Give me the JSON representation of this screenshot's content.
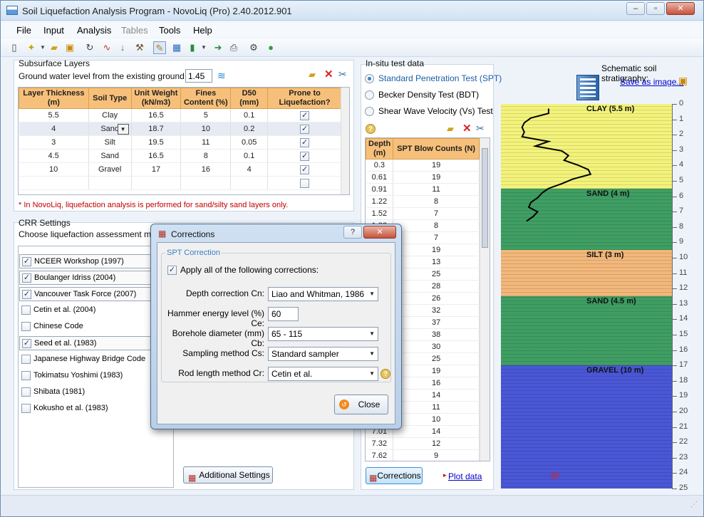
{
  "window": {
    "title": "Soil Liquefaction Analysis Program - NovoLiq (Pro) 2.40.2012.901",
    "min": "‒",
    "max": "▫",
    "close": "✕"
  },
  "menu": [
    "File",
    "Input",
    "Analysis",
    "Tables",
    "Tools",
    "Help"
  ],
  "subsurface": {
    "title": "Subsurface Layers",
    "gw_label": "Ground water level from the existing ground (m):",
    "gw_value": "1.45",
    "headers": [
      "Layer Thickness (m)",
      "Soil Type",
      "Unit Weight (kN/m3)",
      "Fines Content (%)",
      "D50 (mm)",
      "Prone to Liquefaction?"
    ],
    "rows": [
      [
        "5.5",
        "Clay",
        "16.5",
        "5",
        "0.1",
        true
      ],
      [
        "4",
        "Sand",
        "18.7",
        "10",
        "0.2",
        true
      ],
      [
        "3",
        "Silt",
        "19.5",
        "11",
        "0.05",
        true
      ],
      [
        "4.5",
        "Sand",
        "16.5",
        "8",
        "0.1",
        true
      ],
      [
        "10",
        "Gravel",
        "17",
        "16",
        "4",
        true
      ],
      [
        "",
        "",
        "",
        "",
        "",
        false
      ]
    ],
    "note": "* In NovoLiq, liquefaction analysis is performed for sand/silty sand layers only."
  },
  "crr": {
    "title": "CRR Settings",
    "subtitle": "Choose liquefaction assessment metho",
    "methods": [
      {
        "label": "NCEER Workshop (1997)",
        "checked": true
      },
      {
        "label": "Boulanger  Idriss (2004)",
        "checked": true
      },
      {
        "label": "Vancouver Task Force (2007)",
        "checked": true
      },
      {
        "label": "Cetin et al. (2004)",
        "checked": false
      },
      {
        "label": "Chinese Code",
        "checked": false
      },
      {
        "label": "Seed et al. (1983)",
        "checked": true
      },
      {
        "label": "Japanese Highway Bridge Code",
        "checked": false
      },
      {
        "label": "Tokimatsu  Yoshimi (1983)",
        "checked": false
      },
      {
        "label": "Shibata (1981)",
        "checked": false
      },
      {
        "label": "Kokusho et al. (1983)",
        "checked": false
      }
    ],
    "additional_btn": "Additional Settings"
  },
  "insitu": {
    "title": "In-situ test data",
    "options": [
      {
        "label": "Standard Penetration Test (SPT)",
        "selected": true
      },
      {
        "label": "Becker Density Test (BDT)",
        "selected": false
      },
      {
        "label": "Shear Wave Velocity (Vs) Test",
        "selected": false
      }
    ],
    "headers": [
      "Depth (m)",
      "SPT Blow Counts (N)"
    ],
    "rows": [
      [
        "0.3",
        "19"
      ],
      [
        "0.61",
        "19"
      ],
      [
        "0.91",
        "11"
      ],
      [
        "1.22",
        "8"
      ],
      [
        "1.52",
        "7"
      ],
      [
        "1.83",
        "8"
      ],
      [
        "2.13",
        "7"
      ],
      [
        "2.44",
        "19"
      ],
      [
        "2.74",
        "13"
      ],
      [
        "3.05",
        "25"
      ],
      [
        "3.35",
        "28"
      ],
      [
        "3.66",
        "26"
      ],
      [
        "3.96",
        "32"
      ],
      [
        "4.27",
        "37"
      ],
      [
        "4.57",
        "38"
      ],
      [
        "4.88",
        "30"
      ],
      [
        "5.18",
        "25"
      ],
      [
        "5.49",
        "19"
      ],
      [
        "5.79",
        "16"
      ],
      [
        "6.1",
        "14"
      ],
      [
        "6.4",
        "11"
      ],
      [
        "6.71",
        "10"
      ],
      [
        "7.01",
        "14"
      ],
      [
        "7.32",
        "12"
      ],
      [
        "7.62",
        "9"
      ]
    ],
    "corrections_btn": "Corrections",
    "plot_link": "Plot data"
  },
  "schematic": {
    "title": "Schematic soil stratigraphy:",
    "save_link": "Save as image...",
    "layers": [
      {
        "label": "CLAY (5.5 m)",
        "thickness": 5.5,
        "color": "#f3f37c"
      },
      {
        "label": "SAND (4 m)",
        "thickness": 4,
        "color": "#3f9e63"
      },
      {
        "label": "SILT (3 m)",
        "thickness": 3,
        "color": "#f2b77a"
      },
      {
        "label": "SAND (4.5 m)",
        "thickness": 4.5,
        "color": "#3f9e63"
      },
      {
        "label": "GRAVEL (10 m)",
        "thickness": 10,
        "color": "#4a57d6"
      }
    ],
    "ticks": [
      "0",
      "1",
      "2",
      "3",
      "4",
      "5",
      "6",
      "7",
      "8",
      "9",
      "10",
      "11",
      "12",
      "13",
      "14",
      "15",
      "16",
      "17",
      "18",
      "19",
      "20",
      "21",
      "22",
      "23",
      "24",
      "25"
    ],
    "marker": "37"
  },
  "dialog": {
    "title": "Corrections",
    "help": "?",
    "close": "✕",
    "group": "SPT Correction",
    "apply_all": "Apply all of the following corrections:",
    "fields": [
      {
        "label": "Depth correction Cn:",
        "value": "Liao and Whitman, 1986",
        "type": "combo"
      },
      {
        "label": "Hammer energy level (%) Ce:",
        "value": "60",
        "type": "text"
      },
      {
        "label": "Borehole diameter (mm) Cb:",
        "value": "65 - 115",
        "type": "combo"
      },
      {
        "label": "Sampling method Cs:",
        "value": "Standard sampler",
        "type": "combo"
      },
      {
        "label": "Rod length method Cr:",
        "value": "Cetin et al.",
        "type": "combo"
      }
    ],
    "close_btn": "Close"
  }
}
